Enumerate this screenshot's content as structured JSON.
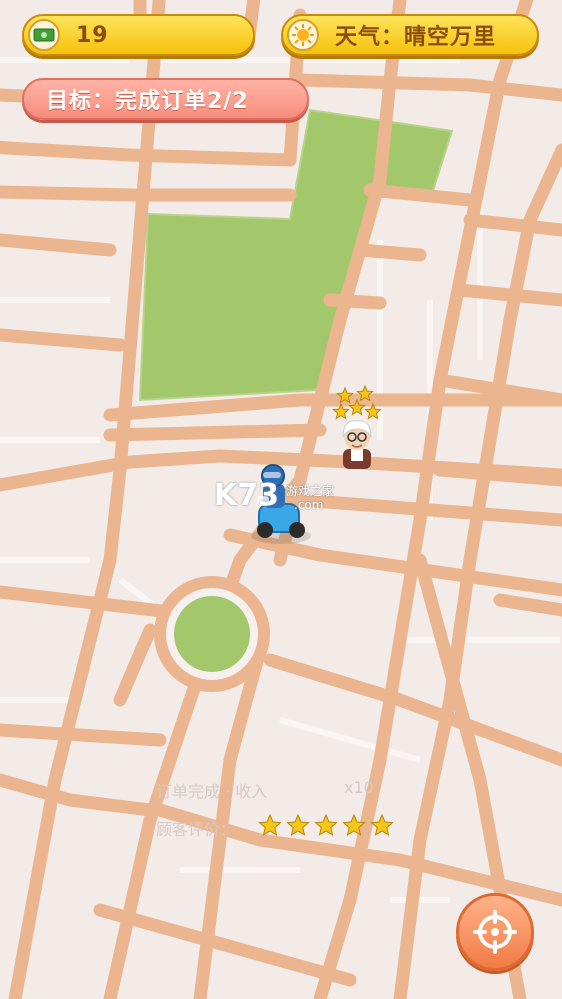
{
  "hud": {
    "money": "19",
    "weather": "天气：晴空万里",
    "goal": "目标：完成订单2/2"
  },
  "icons": {
    "money": "cash-icon",
    "weather": "sun-icon",
    "locate": "crosshair-icon",
    "customer": "elderly-man-icon",
    "courier": "delivery-scooter-icon"
  },
  "customer": {
    "stars": 5
  },
  "rating": {
    "faded_line1": "订单完成 · 收入",
    "faded_count": "x10",
    "faded_line2": "顾客评价：",
    "stars": 5
  },
  "watermark": {
    "logo": "K73",
    "site": "游戏之家",
    "domain": ".com"
  },
  "colors": {
    "road": "#ebb68f",
    "block": "#f3ebe8",
    "park": "#a3c86c",
    "hud_yellow": "#f6c20c",
    "hud_pink": "#f68d7c",
    "star": "#f5c518"
  }
}
